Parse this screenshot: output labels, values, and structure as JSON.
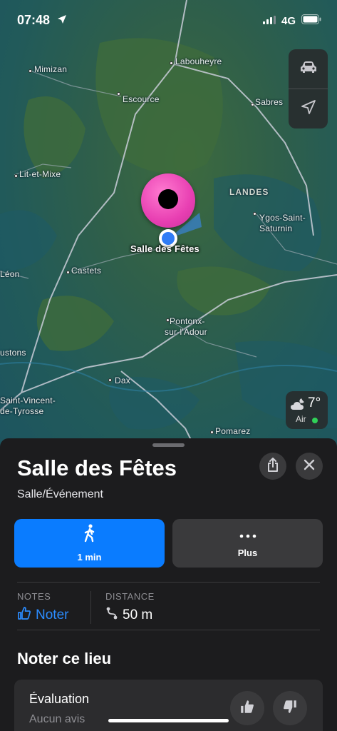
{
  "status_bar": {
    "time": "07:48",
    "network": "4G"
  },
  "map": {
    "labels": {
      "mimizan": "Mimizan",
      "labouheyre": "Labouheyre",
      "escource": "Escource",
      "sabres": "Sabres",
      "lit_et_mixe": "Lit-et-Mixe",
      "landes": "LANDES",
      "ygos_1": "Ygos-Saint-",
      "ygos_2": "Saturnin",
      "leon": "Léon",
      "castets": "Castets",
      "pontonx_1": "Pontonx-",
      "pontonx_2": "sur-l'Adour",
      "ustons": "ustons",
      "dax": "Dax",
      "saint_vincent_1": "Saint-Vincent-",
      "saint_vincent_2": "de-Tyrosse",
      "pomarez": "Pomarez"
    },
    "pin_label": "Salle des Fêtes",
    "controls": {
      "drive_icon": "car-icon",
      "locate_icon": "location-arrow-icon"
    },
    "weather": {
      "temperature": "7°",
      "air_label": "Air",
      "air_color": "#30d158"
    }
  },
  "sheet": {
    "title": "Salle des Fêtes",
    "category": "Salle/Événement",
    "actions": {
      "walk_label": "1 min",
      "more_label": "Plus"
    },
    "info": {
      "notes_header": "NOTES",
      "notes_value": "Noter",
      "distance_header": "DISTANCE",
      "distance_value": "50 m"
    },
    "rate_section_title": "Noter ce lieu",
    "rating": {
      "title": "Évaluation",
      "subtitle": "Aucun avis"
    }
  },
  "colors": {
    "accent": "#0a7cff",
    "pin": "#e83fb2",
    "sheet_bg": "#1c1c1e"
  }
}
